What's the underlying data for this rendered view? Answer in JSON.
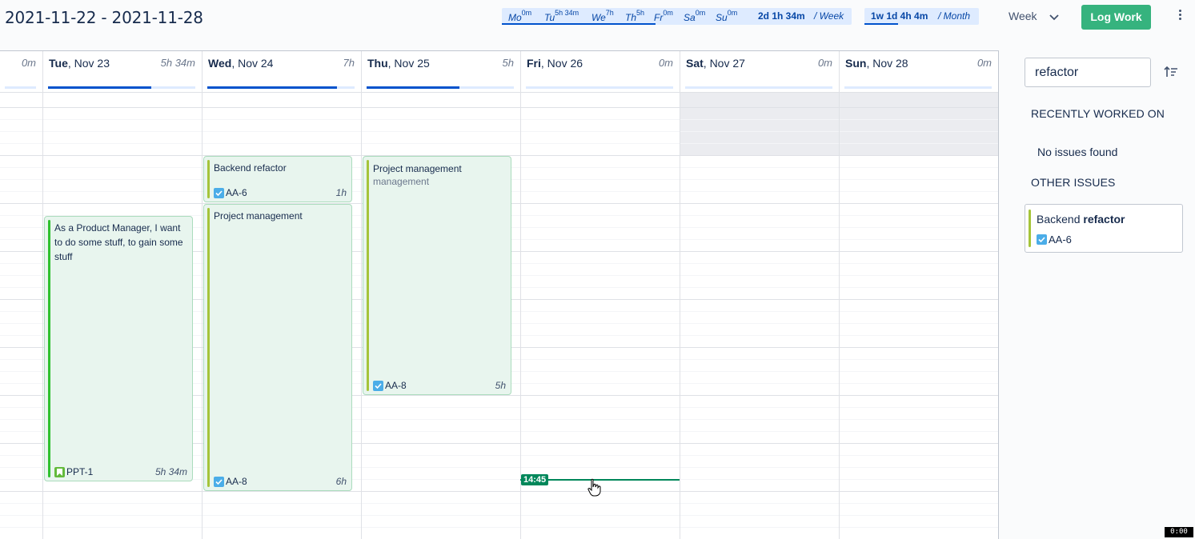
{
  "header": {
    "date_range": "2021-11-22 - 2021-11-28",
    "week_summary": {
      "days": [
        {
          "label": "Mo",
          "value": "0m"
        },
        {
          "label": "Tu",
          "value": "5h 34m"
        },
        {
          "label": "We",
          "value": "7h"
        },
        {
          "label": "Th",
          "value": "5h"
        },
        {
          "label": "Fr",
          "value": "0m"
        },
        {
          "label": "Sa",
          "value": "0m"
        },
        {
          "label": "Su",
          "value": "0m"
        }
      ],
      "total": "2d 1h 34m",
      "period": "/ Week"
    },
    "month_summary": {
      "total": "1w 1d 4h 4m",
      "period": "/ Month"
    },
    "view_select": "Week",
    "log_work_label": "Log Work"
  },
  "calendar": {
    "columns": [
      {
        "day": "",
        "date": "",
        "hours": "0m",
        "progress": 0
      },
      {
        "day": "Tue",
        "date": ", Nov 23",
        "hours": "5h 34m",
        "progress": 0.7
      },
      {
        "day": "Wed",
        "date": ", Nov 24",
        "hours": "7h",
        "progress": 0.88
      },
      {
        "day": "Thu",
        "date": ", Nov 25",
        "hours": "5h",
        "progress": 0.63
      },
      {
        "day": "Fri",
        "date": ", Nov 26",
        "hours": "0m",
        "progress": 0
      },
      {
        "day": "Sat",
        "date": ", Nov 27",
        "hours": "0m",
        "progress": 0
      },
      {
        "day": "Sun",
        "date": ", Nov 28",
        "hours": "0m",
        "progress": 0
      }
    ],
    "worklogs": [
      {
        "title": "As a Product Manager, I want to do some stuff, to gain some stuff",
        "subtitle": "",
        "key": "PPT-1",
        "type": "story",
        "duration": "5h 34m"
      },
      {
        "title": "Backend refactor",
        "subtitle": "",
        "key": "AA-6",
        "type": "task",
        "duration": "1h"
      },
      {
        "title": "Project management",
        "subtitle": "",
        "key": "AA-8",
        "type": "task",
        "duration": "6h"
      },
      {
        "title": "Project management",
        "subtitle": "management",
        "key": "AA-8",
        "type": "task",
        "duration": "5h"
      }
    ],
    "current_time": "14:45"
  },
  "panel": {
    "search_value": "refactor",
    "recent_title": "RECENTLY WORKED ON",
    "recent_empty": "No issues found",
    "other_title": "OTHER ISSUES",
    "other_issue": {
      "title_plain": "Backend ",
      "title_match": "refactor",
      "key": "AA-6"
    }
  },
  "recording_badge": "0:00",
  "colors": {
    "accent": "#0052cc",
    "log_button": "#36b37e",
    "now_line": "#00875a",
    "card_bg": "#e8f5ee",
    "stripe_green": "#2fc12f",
    "stripe_olive": "#a5c43a"
  }
}
